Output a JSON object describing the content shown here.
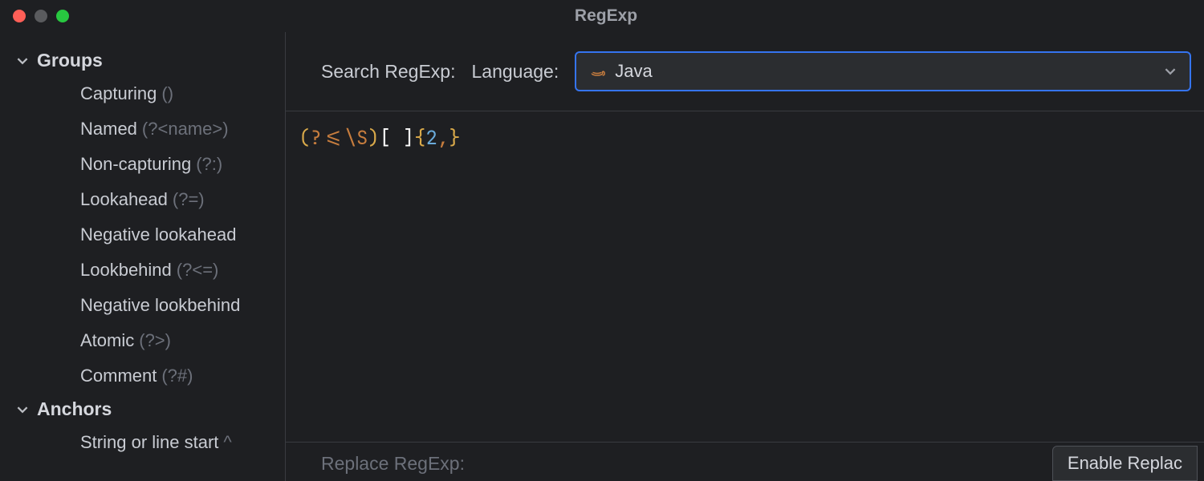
{
  "window": {
    "title": "RegExp"
  },
  "sidebar": {
    "sections": [
      {
        "label": "Groups",
        "expanded": true,
        "items": [
          {
            "label": "Capturing",
            "suffix": "()"
          },
          {
            "label": "Named",
            "suffix": "(?<name>)"
          },
          {
            "label": "Non-capturing",
            "suffix": "(?:)"
          },
          {
            "label": "Lookahead",
            "suffix": "(?=)"
          },
          {
            "label": "Negative lookahead",
            "suffix": ""
          },
          {
            "label": "Lookbehind",
            "suffix": "(?<=)"
          },
          {
            "label": "Negative lookbehind",
            "suffix": ""
          },
          {
            "label": "Atomic",
            "suffix": "(?>)"
          },
          {
            "label": "Comment",
            "suffix": "(?#)"
          }
        ]
      },
      {
        "label": "Anchors",
        "expanded": true,
        "items": [
          {
            "label": "String or line start",
            "suffix": "^"
          }
        ]
      }
    ]
  },
  "toolbar": {
    "search_label": "Search RegExp:",
    "language_label": "Language:",
    "language_value": "Java"
  },
  "editor": {
    "regex_tokens": [
      {
        "t": "(",
        "c": "delim"
      },
      {
        "t": "?<=",
        "c": "esc"
      },
      {
        "t": "\\S",
        "c": "esc"
      },
      {
        "t": ")",
        "c": "delim"
      },
      {
        "t": "[ ]",
        "c": "br"
      },
      {
        "t": "{",
        "c": "delim"
      },
      {
        "t": "2",
        "c": "num"
      },
      {
        "t": ",",
        "c": "comma"
      },
      {
        "t": "}",
        "c": "delim"
      }
    ]
  },
  "bottom": {
    "replace_label": "Replace RegExp:",
    "enable_button": "Enable Replac"
  }
}
